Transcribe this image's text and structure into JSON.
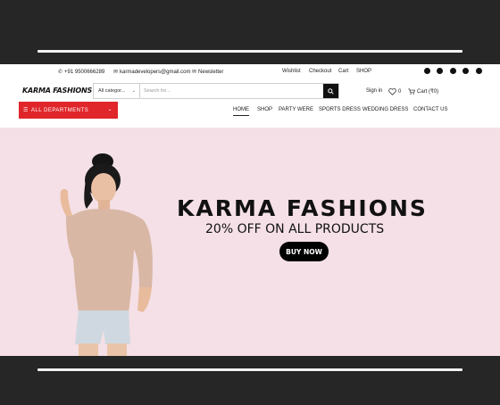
{
  "topbar": {
    "phone": "+91 9500666289",
    "email": "karmadevelopers@gmail.com",
    "newsletter": "Newsletter",
    "links": [
      "Wishlist",
      "Checkout",
      "Cart",
      "SHOP"
    ],
    "social": [
      "facebook-icon",
      "twitter-icon",
      "pinterest-icon",
      "instagram-icon",
      "linkedin-icon"
    ]
  },
  "header": {
    "logo": "KARMA FASHIONS",
    "category": "All categor...",
    "search_placeholder": "Search for...",
    "signin": "Sign in",
    "wishlist_count": "0",
    "cart": "Cart (₹0)"
  },
  "nav": {
    "departments": "ALL DEPARTMENTS",
    "items": [
      "HOME",
      "SHOP",
      "PARTY WERE",
      "SPORTS DRESS",
      "WEDDING DRESS",
      "CONTACT US"
    ]
  },
  "hero": {
    "title": "KARMA FASHIONS",
    "subtitle": "20% OFF ON ALL PRODUCTS",
    "button": "BUY NOW"
  },
  "colors": {
    "accent": "#e0262a",
    "hero_bg": "#f4e0e6",
    "frame": "#262626"
  }
}
